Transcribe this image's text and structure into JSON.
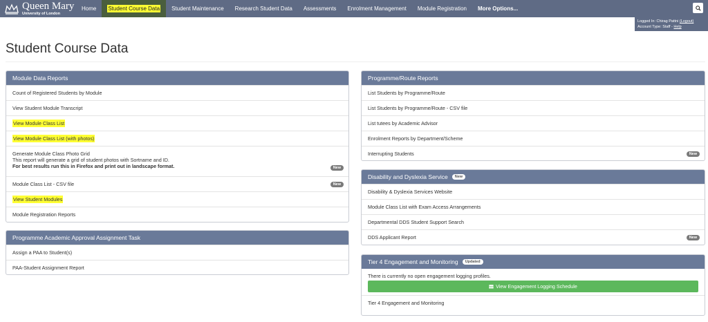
{
  "brand": {
    "name": "Queen Mary",
    "subtitle": "University of London"
  },
  "nav": {
    "items": [
      {
        "label": "Home"
      },
      {
        "label": "Student Course Data"
      },
      {
        "label": "Student Maintenance"
      },
      {
        "label": "Research Student Data"
      },
      {
        "label": "Assessments"
      },
      {
        "label": "Enrolment Management"
      },
      {
        "label": "Module Registration"
      },
      {
        "label": "More Options..."
      }
    ]
  },
  "user": {
    "logged_in_prefix": "Logged In: Chirag Pattni",
    "logout": "(Logout)",
    "account_type": "Account Type: Staff - ",
    "help": "Help"
  },
  "page": {
    "title": "Student Course Data"
  },
  "panels": {
    "module_reports": {
      "title": "Module Data Reports",
      "items": [
        {
          "label": "Count of Registered Students by Module"
        },
        {
          "label": "View Student Module Transcript"
        },
        {
          "label": "View Module Class List"
        },
        {
          "label": "View Module Class List (with photos)"
        },
        {
          "label": "Generate Module Class Photo Grid",
          "line2": "This report will generate a grid of student photos with Sortname and ID.",
          "line3": "For best results run this in Firefox and print out in landscape format.",
          "badge": "New"
        },
        {
          "label": "Module Class List - CSV file",
          "badge": "New"
        },
        {
          "label": "View Student Modules"
        },
        {
          "label": "Module Registration Reports"
        }
      ]
    },
    "paa": {
      "title": "Programme Academic Approval Assignment Task",
      "items": [
        {
          "label": "Assign a PAA to Student(s)"
        },
        {
          "label": "PAA-Student Assignment Report"
        }
      ]
    },
    "programme": {
      "title": "Programme/Route Reports",
      "items": [
        {
          "label": "List Students by Programme/Route"
        },
        {
          "label": "List Students by Programme/Route - CSV file"
        },
        {
          "label": "List tutees by Academic Advisor"
        },
        {
          "label": "Enrolment Reports by Department/Scheme"
        },
        {
          "label": "Interrupting Students",
          "badge": "New"
        }
      ]
    },
    "dds": {
      "title": "Disability and Dyslexia Service",
      "title_badge": "New",
      "items": [
        {
          "label": "Disability & Dyslexia Services Website"
        },
        {
          "label": "Module Class List with Exam Access Arrangements"
        },
        {
          "label": "Departmental DDS Student Support Search"
        },
        {
          "label": "DDS Applicant Report",
          "badge": "New"
        }
      ]
    },
    "tier4": {
      "title": "Tier 4 Engagement and Monitoring",
      "title_badge": "Updated",
      "notice": "There is currently no open engagement logging profiles.",
      "button": "View Engagement Logging Schedule",
      "items": [
        {
          "label": "Tier 4 Engagement and Monitoring"
        }
      ]
    }
  },
  "colors": {
    "nav_bg": "#5f6b85",
    "panel_head": "#6a7a99",
    "highlight": "#ffff33",
    "active_nav": "#4a5e3d",
    "green": "#5cb85c"
  }
}
